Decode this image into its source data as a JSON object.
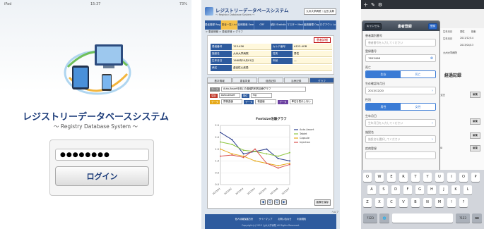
{
  "login": {
    "status_left": "iPad",
    "status_time": "15:37",
    "status_battery": "73%",
    "title": "レジストリーデータベースシステム",
    "subtitle": "～ Registry Database System ～",
    "password_value": "●●●●●●●●",
    "login_label": "ログイン"
  },
  "app": {
    "title": "レジストリーデータベースシステム",
    "subtitle": "～ Registry Database System ～",
    "user_box": "九州大学病院｜山田 太郎",
    "nav": [
      "患者登録 Regist",
      "患者一覧 List",
      "症例検索 Search",
      "CRF",
      "統計 Statistic",
      "マスター Master",
      "組織管理 Org",
      "ログアウト Logout"
    ],
    "breadcrumb": "> 患者情報 > 患者詳細 > グラフ",
    "card_title": "患者詳細",
    "info_rows": [
      {
        "k": "患者番号",
        "v": "123-456",
        "k2": "カルテ番号",
        "v2": "A123-4OB"
      },
      {
        "k": "施設名",
        "v": "九州大学病院",
        "k2": "性別",
        "v2": "男性"
      },
      {
        "k": "生年月日",
        "v": "1980年10月01日",
        "k2": "年齢",
        "v2": "―"
      },
      {
        "k": "病名",
        "v": "虚血性心疾患",
        "k2": "",
        "v2": ""
      }
    ],
    "tabs": [
      "基本情報",
      "患者背景",
      "経過記録",
      "治療記録",
      "グラフ"
    ],
    "filter1_label": "コース",
    "filter1_value": "Auto-Assortを用いた各種内科的治療グラフ",
    "filter2_label": "項目",
    "filter2_value": "Auto-Assort",
    "filter2b_label": "単位",
    "filter2b_value": "mg",
    "filter3_label": "データ",
    "filter3_value": "尿検査値",
    "filter3b_label": "データ",
    "filter3b_value": "検査値",
    "filter3c_label": "データ",
    "filter3c_value": "単位を表示しない",
    "chart_title": "Fontsize治験グラフ",
    "pager": [
      "◀",
      "Q",
      "Q",
      "▶"
    ],
    "save_label": "画像を保存",
    "help_label": "ヘルプ",
    "footer_links": [
      "個人情報保護方針",
      "サイトマップ",
      "お問い合わせ",
      "利用規約"
    ],
    "copyright": "Copyright(c) 2013 九州大学病院 All Rights Reserved."
  },
  "chart_data": {
    "type": "line",
    "title": "Fontsize治験グラフ",
    "xlabel": "",
    "ylabel": "",
    "categories": [
      "2013/01",
      "2013/02",
      "2013/03",
      "2013/04",
      "2013/05",
      "2013/06",
      "2013/07"
    ],
    "ylim": [
      0,
      2.5
    ],
    "grid": true,
    "legend": "top-right",
    "series": [
      {
        "name": "Auto-Assort",
        "color": "#2c3e8f",
        "values": [
          2.2,
          1.9,
          1.3,
          1.4,
          1.5,
          1.1,
          1.0
        ]
      },
      {
        "name": "Tablet",
        "color": "#8cc63f",
        "values": [
          1.8,
          1.7,
          1.45,
          1.4,
          1.3,
          1.2,
          1.35
        ]
      },
      {
        "name": "Capsule",
        "color": "#e6a817",
        "values": [
          1.5,
          1.3,
          1.2,
          1.0,
          0.9,
          0.8,
          0.9
        ]
      },
      {
        "name": "Injection",
        "color": "#d9534f",
        "values": [
          1.2,
          1.25,
          1.15,
          1.5,
          0.9,
          0.7,
          0.85
        ]
      }
    ]
  },
  "reg": {
    "popover_title": "患者登録",
    "cancel_label": "キャンセル",
    "confirm_label": "登録",
    "label_patient_no": "患者識別番号",
    "ph_patient_no": "患者番号を入力してください",
    "label_karte": "登録番号",
    "karte_value": "7653498",
    "label_sex": "死亡",
    "sex_options": [
      "生存",
      "死亡"
    ],
    "label_regdate": "生存確認年月日",
    "regdate_value": "2013/12/20",
    "label_gender": "性別",
    "gender_options": [
      "男性",
      "女性"
    ],
    "label_birth": "生年月日",
    "ph_birth": "生年月日を入力してください",
    "label_facility": "施設名",
    "ph_facility": "施設名を選択してください",
    "label_disease": "疾病登録",
    "bg_cells": [
      "4Z",
      "生年月日",
      "男性",
      "検索",
      "生年月日",
      "2011/12/14",
      "2013/04/13",
      "九州大学病院"
    ],
    "bg_heading": "経過記録",
    "bg_row_text": "治療開始予定日",
    "bg_edit": "編集",
    "bg_date": "2013/12/30",
    "kb_rows": [
      [
        "Q",
        "W",
        "E",
        "R",
        "T",
        "Y",
        "U",
        "I",
        "O",
        "P"
      ],
      [
        "A",
        "S",
        "D",
        "F",
        "G",
        "H",
        "J",
        "K",
        "L"
      ],
      [
        "Z",
        "X",
        "C",
        "V",
        "B",
        "N",
        "M",
        "!",
        "?"
      ]
    ],
    "kb_bottom": [
      "?123",
      "🌐",
      "?123"
    ]
  }
}
